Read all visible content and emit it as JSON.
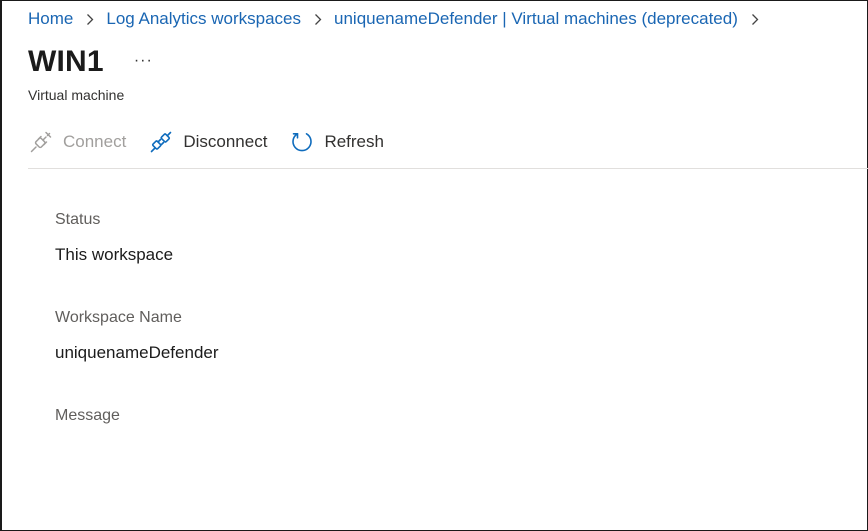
{
  "breadcrumb": {
    "items": [
      {
        "label": "Home"
      },
      {
        "label": "Log Analytics workspaces"
      },
      {
        "label": "uniquenameDefender | Virtual machines (deprecated)"
      }
    ]
  },
  "header": {
    "title": "WIN1",
    "more_label": "···",
    "subtitle": "Virtual machine"
  },
  "toolbar": {
    "connect": {
      "label": "Connect",
      "icon": "plug-connect-icon",
      "enabled": false
    },
    "disconnect": {
      "label": "Disconnect",
      "icon": "plug-disconnect-icon",
      "enabled": true
    },
    "refresh": {
      "label": "Refresh",
      "icon": "refresh-icon",
      "enabled": true
    }
  },
  "details": {
    "status_label": "Status",
    "status_value": "This workspace",
    "workspace_label": "Workspace Name",
    "workspace_value": "uniquenameDefender",
    "message_label": "Message",
    "message_value": ""
  },
  "colors": {
    "link": "#1a66b3",
    "icon_blue": "#0f6cbd",
    "disabled": "#a19f9d",
    "divider": "#e1dfdd"
  }
}
